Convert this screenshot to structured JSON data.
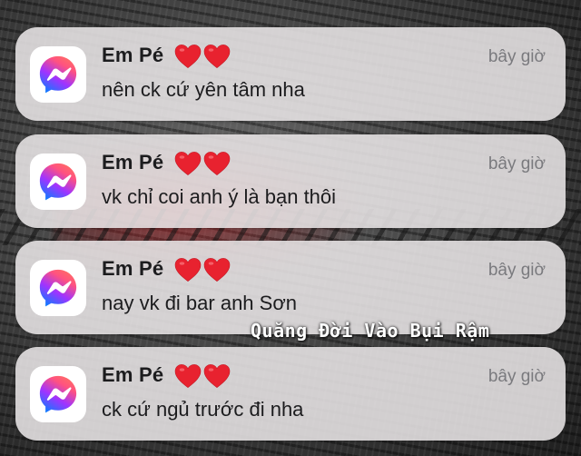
{
  "app": {
    "name": "Messenger",
    "icon": "messenger-icon",
    "icon_gradient": [
      "#0a7cff",
      "#a033ff",
      "#ff5280",
      "#ff7061"
    ]
  },
  "notifications": [
    {
      "sender": "Em Pé",
      "sender_emoji": "red-heart-icon red-heart-icon",
      "time": "bây giờ",
      "message": "nên ck cứ yên tâm nha"
    },
    {
      "sender": "Em Pé",
      "sender_emoji": "red-heart-icon red-heart-icon",
      "time": "bây giờ",
      "message": "vk chỉ coi anh ý là bạn thôi"
    },
    {
      "sender": "Em Pé",
      "sender_emoji": "red-heart-icon red-heart-icon",
      "time": "bây giờ",
      "message": "nay vk đi bar anh Sơn"
    },
    {
      "sender": "Em Pé",
      "sender_emoji": "red-heart-icon red-heart-icon",
      "time": "bây giờ",
      "message": "ck cứ ngủ trước đi nha"
    }
  ],
  "watermark": "Quăng Đời Vào Bụi Rậm",
  "colors": {
    "heart": "#e8222f",
    "card": "#e8e5e6",
    "time_text": "#7a7a7e"
  }
}
